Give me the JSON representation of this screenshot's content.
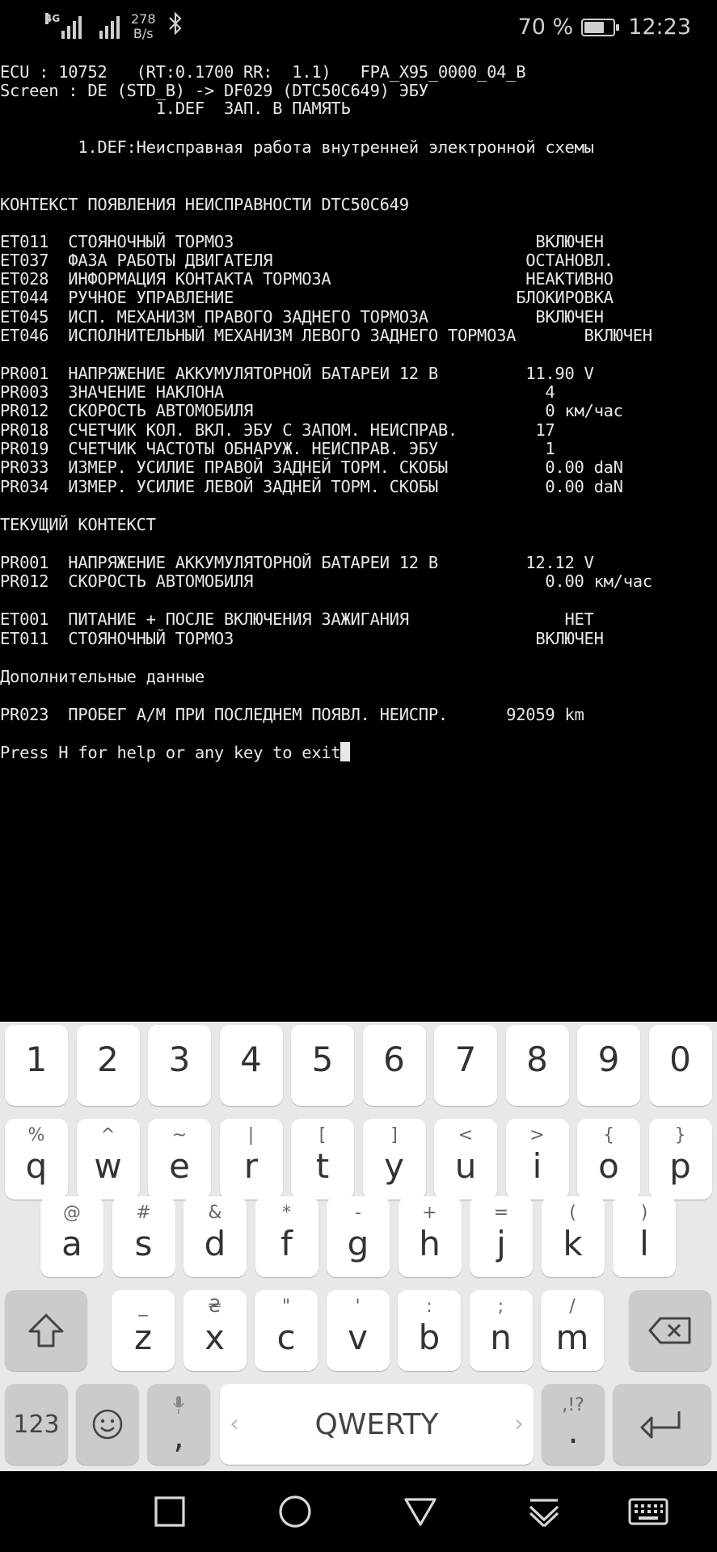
{
  "status_bar": {
    "network_type": "4G",
    "net_speed_value": "278",
    "net_speed_unit": "B/s",
    "battery_percent": "70 %",
    "battery_level": 0.7,
    "time": "12:23",
    "icons": [
      "signal-icon",
      "signal-icon",
      "bluetooth-icon",
      "battery-icon"
    ]
  },
  "terminal": {
    "lines": [
      "ECU : 10752   (RT:0.1700 RR:  1.1)   FPA_X95_0000_04_B",
      "Screen : DE (STD_B) -> DF029 (DTC50C649) ЭБУ",
      "                1.DEF  ЗАП. В ПАМЯТЬ",
      "",
      "        1.DEF:Неисправная работа внутренней электронной схемы",
      "",
      "",
      "КОНТЕКСТ ПОЯВЛЕНИЯ НЕИСПРАВНОСТИ DTC50C649",
      "",
      "ET011  СТОЯНОЧНЫЙ ТОРМОЗ                               ВКЛЮЧЕН",
      "ET037  ФАЗА РАБОТЫ ДВИГАТЕЛЯ                          ОСТАНОВЛ.",
      "ET028  ИНФОРМАЦИЯ КОНТАКТА ТОРМОЗА                    НЕАКТИВНО",
      "ET044  РУЧНОЕ УПРАВЛЕНИЕ                             БЛОКИРОВКА",
      "ET045  ИСП. МЕХАНИЗМ ПРАВОГО ЗАДНЕГО ТОРМОЗА           ВКЛЮЧЕН",
      "ET046  ИСПОЛНИТЕЛЬНЫЙ МЕХАНИЗМ ЛЕВОГО ЗАДНЕГО ТОРМОЗА       ВКЛЮЧЕН",
      "",
      "PR001  НАПРЯЖЕНИЕ АККУМУЛЯТОРНОЙ БАТАРЕИ 12 В         11.90 V",
      "PR003  ЗНАЧЕНИЕ НАКЛОНА                                 4",
      "PR012  СКОРОСТЬ АВТОМОБИЛЯ                              0 км/час",
      "PR018  СЧЕТЧИК КОЛ. ВКЛ. ЭБУ С ЗАПОМ. НЕИСПРАВ.        17",
      "PR019  СЧЕТЧИК ЧАСТОТЫ ОБНАРУЖ. НЕИСПРАВ. ЭБУ           1",
      "PR033  ИЗМЕР. УСИЛИЕ ПРАВОЙ ЗАДНЕЙ ТОРМ. СКОБЫ          0.00 daN",
      "PR034  ИЗМЕР. УСИЛИЕ ЛЕВОЙ ЗАДНЕЙ ТОРМ. СКОБЫ           0.00 daN",
      "",
      "ТЕКУЩИЙ КОНТЕКСТ",
      "",
      "PR001  НАПРЯЖЕНИЕ АККУМУЛЯТОРНОЙ БАТАРЕИ 12 В         12.12 V",
      "PR012  СКОРОСТЬ АВТОМОБИЛЯ                              0.00 км/час",
      "",
      "ET001  ПИТАНИЕ + ПОСЛЕ ВКЛЮЧЕНИЯ ЗАЖИГАНИЯ                НЕТ",
      "ET011  СТОЯНОЧНЫЙ ТОРМОЗ                               ВКЛЮЧЕН",
      "",
      "Дополнительные данные",
      "",
      "PR023  ПРОБЕГ А/М ПРИ ПОСЛЕДНЕМ ПОЯВЛ. НЕИСПР.      92059 km",
      "",
      "Press H for help or any key to exit"
    ]
  },
  "keyboard": {
    "number_row": [
      "1",
      "2",
      "3",
      "4",
      "5",
      "6",
      "7",
      "8",
      "9",
      "0"
    ],
    "row1": [
      {
        "main": "q",
        "sub": "%"
      },
      {
        "main": "w",
        "sub": "^"
      },
      {
        "main": "e",
        "sub": "~"
      },
      {
        "main": "r",
        "sub": "|"
      },
      {
        "main": "t",
        "sub": "["
      },
      {
        "main": "y",
        "sub": "]"
      },
      {
        "main": "u",
        "sub": "<"
      },
      {
        "main": "i",
        "sub": ">"
      },
      {
        "main": "o",
        "sub": "{"
      },
      {
        "main": "p",
        "sub": "}"
      }
    ],
    "row2": [
      {
        "main": "a",
        "sub": "@"
      },
      {
        "main": "s",
        "sub": "#"
      },
      {
        "main": "d",
        "sub": "&"
      },
      {
        "main": "f",
        "sub": "*"
      },
      {
        "main": "g",
        "sub": "-"
      },
      {
        "main": "h",
        "sub": "+"
      },
      {
        "main": "j",
        "sub": "="
      },
      {
        "main": "k",
        "sub": "("
      },
      {
        "main": "l",
        "sub": ")"
      }
    ],
    "row3": [
      {
        "main": "z",
        "sub": "_"
      },
      {
        "main": "x",
        "sub": "₴"
      },
      {
        "main": "c",
        "sub": "\""
      },
      {
        "main": "v",
        "sub": "'"
      },
      {
        "main": "b",
        "sub": ":"
      },
      {
        "main": "n",
        "sub": ";"
      },
      {
        "main": "m",
        "sub": "/"
      }
    ],
    "symbols_label": "123",
    "comma_label": ",",
    "space_label": "QWERTY",
    "space_left_arrow": "‹",
    "space_right_arrow": "›",
    "period_label": ".",
    "period_sub": ",!?"
  },
  "nav_bar": {
    "icons": [
      "recent-apps-icon",
      "home-icon",
      "back-icon",
      "notification-pull-icon",
      "keyboard-switch-icon"
    ]
  }
}
